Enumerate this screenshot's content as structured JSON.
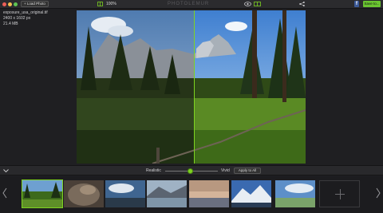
{
  "window": {
    "title": "PHOTOLEMUR",
    "load_label": "+ Load Photo",
    "zoom": "100%",
    "facebook_label": "f",
    "save_label": "Save to..."
  },
  "file": {
    "name": "exposure_usa_original.tif",
    "dimensions": "2400 x 1602 px",
    "size": "21.4 MB"
  },
  "controls": {
    "realistic_label": "Realistic",
    "vivid_label": "Vivid",
    "apply_label": "Apply to All",
    "intensity_fraction": 0.48
  },
  "filmstrip": {
    "thumbnails": [
      {
        "name": "meadow-thumb",
        "active": true
      },
      {
        "name": "rock-thumb",
        "active": false
      },
      {
        "name": "clouds-thumb",
        "active": false
      },
      {
        "name": "lake-thumb",
        "active": false
      },
      {
        "name": "sunset-thumb",
        "active": false
      },
      {
        "name": "mountain-thumb",
        "active": false
      },
      {
        "name": "sky-thumb",
        "active": false
      }
    ],
    "add_icon": "plus-icon"
  },
  "colors": {
    "accent": "#7ed321",
    "save": "#6ac431",
    "background": "#1f1f22"
  }
}
